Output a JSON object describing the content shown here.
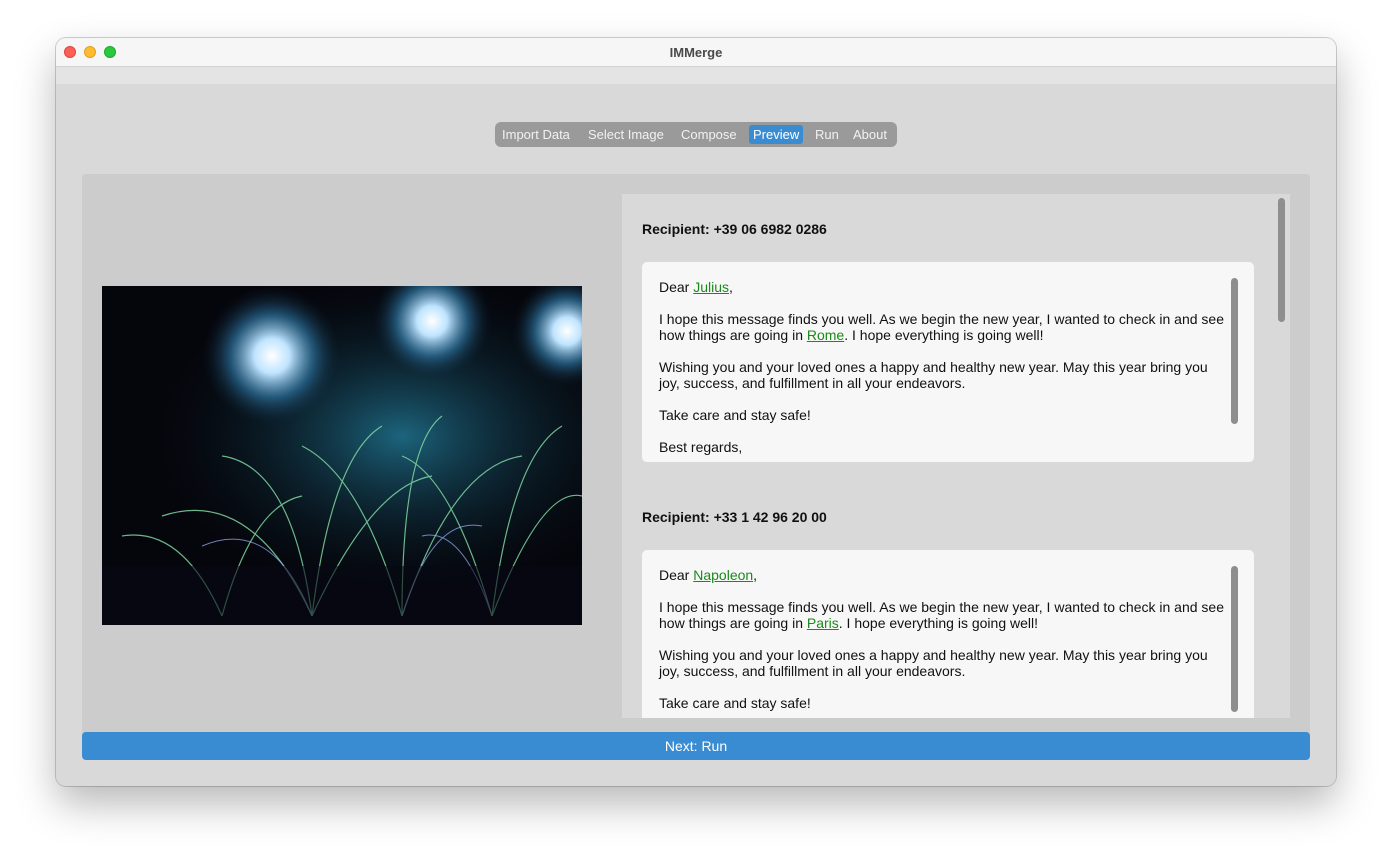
{
  "window": {
    "title": "IMMerge"
  },
  "tabs": [
    {
      "label": "Import Data"
    },
    {
      "label": "Select Image"
    },
    {
      "label": "Compose"
    },
    {
      "label": "Preview",
      "active": true
    },
    {
      "label": "Run"
    },
    {
      "label": "About"
    }
  ],
  "preview": {
    "image": "fireworks-photo",
    "messages": [
      {
        "recipient_label": "Recipient: +39 06 6982 0286",
        "greeting_prefix": "Dear ",
        "name": "Julius",
        "greeting_suffix": ",",
        "line2_prefix": "I hope this message finds you well. As we begin the new year, I wanted to check in and see how things are going in ",
        "city": "Rome",
        "line2_suffix": ". I hope everything is going well!",
        "line3": "Wishing you and your loved ones a happy and healthy new year. May this year bring you joy, success, and fulfillment in all your endeavors.",
        "line4": "Take care and stay safe!",
        "line5": "Best regards,"
      },
      {
        "recipient_label": "Recipient: +33 1 42 96 20 00",
        "greeting_prefix": "Dear ",
        "name": "Napoleon",
        "greeting_suffix": ",",
        "line2_prefix": "I hope this message finds you well. As we begin the new year, I wanted to check in and see how things are going in ",
        "city": "Paris",
        "line2_suffix": ". I hope everything is going well!",
        "line3": "Wishing you and your loved ones a happy and healthy new year. May this year bring you joy, success, and fulfillment in all your endeavors.",
        "line4": "Take care and stay safe!"
      }
    ]
  },
  "next_button": {
    "label": "Next: Run"
  },
  "colors": {
    "accent": "#3a8cd2",
    "variable_link": "#1a8a1a",
    "tab_bar": "#9a9a9a"
  }
}
